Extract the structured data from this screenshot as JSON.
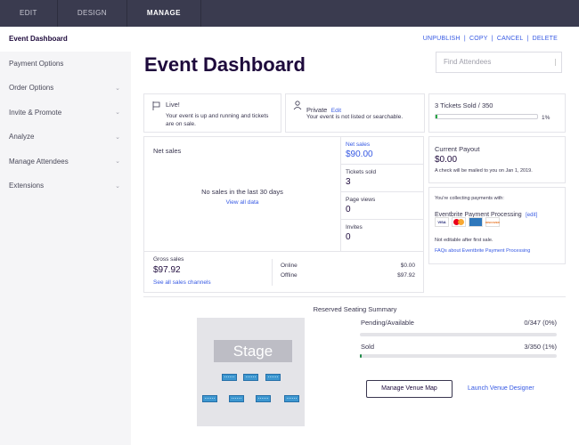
{
  "topnav": {
    "tabs": [
      "EDIT",
      "DESIGN",
      "MANAGE"
    ]
  },
  "sidebar": {
    "items": [
      {
        "label": "Event Dashboard"
      },
      {
        "label": "Payment Options"
      },
      {
        "label": "Order Options"
      },
      {
        "label": "Invite & Promote"
      },
      {
        "label": "Analyze"
      },
      {
        "label": "Manage Attendees"
      },
      {
        "label": "Extensions"
      }
    ]
  },
  "actions": {
    "unpublish": "UNPUBLISH",
    "copy": "COPY",
    "cancel": "CANCEL",
    "delete": "DELETE",
    "sep": "|"
  },
  "page_title": "Event Dashboard",
  "search": {
    "placeholder": "Find Attendees"
  },
  "status": {
    "live_title": "Live!",
    "live_desc": "Your event is up and running and tickets are on sale.",
    "private_title": "Private",
    "private_edit": "Edit",
    "private_desc": "Your event is not listed or searchable."
  },
  "tickets": {
    "label": "3 Tickets Sold / 350",
    "percent_text": "1%",
    "percent": 1
  },
  "net_sales_chart": {
    "title": "Net sales",
    "empty_text": "No sales in the last 30 days",
    "view_all": "View all data"
  },
  "stats": {
    "net_sales_label": "Net sales",
    "net_sales_value": "$90.00",
    "tickets_sold_label": "Tickets sold",
    "tickets_sold_value": "3",
    "page_views_label": "Page views",
    "page_views_value": "0",
    "invites_label": "Invites",
    "invites_value": "0"
  },
  "gross": {
    "label": "Gross sales",
    "value": "$97.92",
    "link": "See all sales channels",
    "online_label": "Online",
    "online_value": "$0.00",
    "offline_label": "Offline",
    "offline_value": "$97.92"
  },
  "payout": {
    "title": "Current Payout",
    "amount": "$0.00",
    "note": "A check will be mailed to you on Jan 1, 2019.",
    "collecting": "You're collecting payments with:",
    "processor": "Eventbrite Payment Processing",
    "edit": "[edit]",
    "cards": [
      "VISA",
      "MC",
      "AMEX",
      "DISCOVER"
    ],
    "not_editable": "Not editable after first sale.",
    "faq": "FAQs about Eventbrite Payment Processing"
  },
  "reserved": {
    "title": "Reserved Seating Summary",
    "stage": "Stage",
    "pending_label": "Pending/Available",
    "pending_value": "0/347 (0%)",
    "pending_fraction": 0,
    "sold_label": "Sold",
    "sold_value": "3/350 (1%)",
    "sold_fraction": 0.01,
    "manage_button": "Manage Venue Map",
    "designer_link": "Launch Venue Designer"
  },
  "colors": {
    "topbar": "#3a3b4f",
    "accent": "#3659e3",
    "progress": "#28a745",
    "seat": "#3d97d0"
  }
}
